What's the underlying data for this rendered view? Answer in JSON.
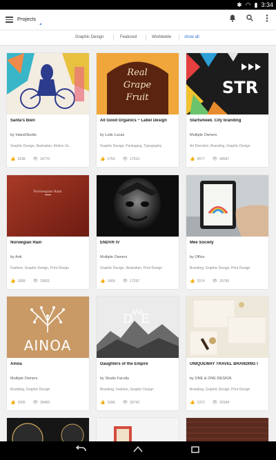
{
  "statusbar": {
    "time": "3:34"
  },
  "appbar": {
    "title": "Projects"
  },
  "filters": [
    {
      "label": "Graphic Design"
    },
    {
      "label": "Featured"
    },
    {
      "label": "Worldwide"
    },
    {
      "label": "show all"
    }
  ],
  "cards": [
    {
      "title": "Santa's Bien",
      "by": "by InlandStudio",
      "fields": "Graphic Design, Illustration, Motion Gr...",
      "likes": "3198",
      "views": "24770"
    },
    {
      "title": "All Good Organics ~ Label Design",
      "by": "by Lulie Lucas",
      "fields": "Graphic Design, Packaging, Typography",
      "likes": "1750",
      "views": "17513"
    },
    {
      "title": "Startsmeek. City branding",
      "by": "Multiple Owners",
      "fields": "Art Direction, Branding, Graphic Design",
      "likes": "3577",
      "views": "40597"
    },
    {
      "title": "Norwegian Rain",
      "by": "by Anti",
      "fields": "Fashion, Graphic Design, Print Design",
      "likes": "1689",
      "views": "20601"
    },
    {
      "title": "ENDVR IV",
      "by": "Multiple Owners",
      "fields": "Graphic Design, Illustration, Print Design",
      "likes": "1409",
      "views": "17297"
    },
    {
      "title": "Mee Society",
      "by": "by Office",
      "fields": "Branding, Graphic Design, Print Design",
      "likes": "1574",
      "views": "20790"
    },
    {
      "title": "Ainoa",
      "by": "Multiple Owners",
      "fields": "Branding, Graphic Design",
      "likes": "1505",
      "views": "20465"
    },
    {
      "title": "Daughters of the Empire",
      "by": "by Studio Faculty",
      "fields": "Branding, Fashion, Graphic Design",
      "likes": "1096",
      "views": "20742"
    },
    {
      "title": "UNIQUEWAY TRAVEL BRANDING I",
      "by": "by ONE & ONE DESIGN",
      "fields": "Branding, Graphic Design, Print Design",
      "likes": "1372",
      "views": "20184"
    }
  ],
  "thumb_text": {
    "card1": "Real Grape Fruit",
    "card2": "STR",
    "card3": "Norwegian Rain",
    "card6": "AINOA",
    "card7": "D E"
  }
}
